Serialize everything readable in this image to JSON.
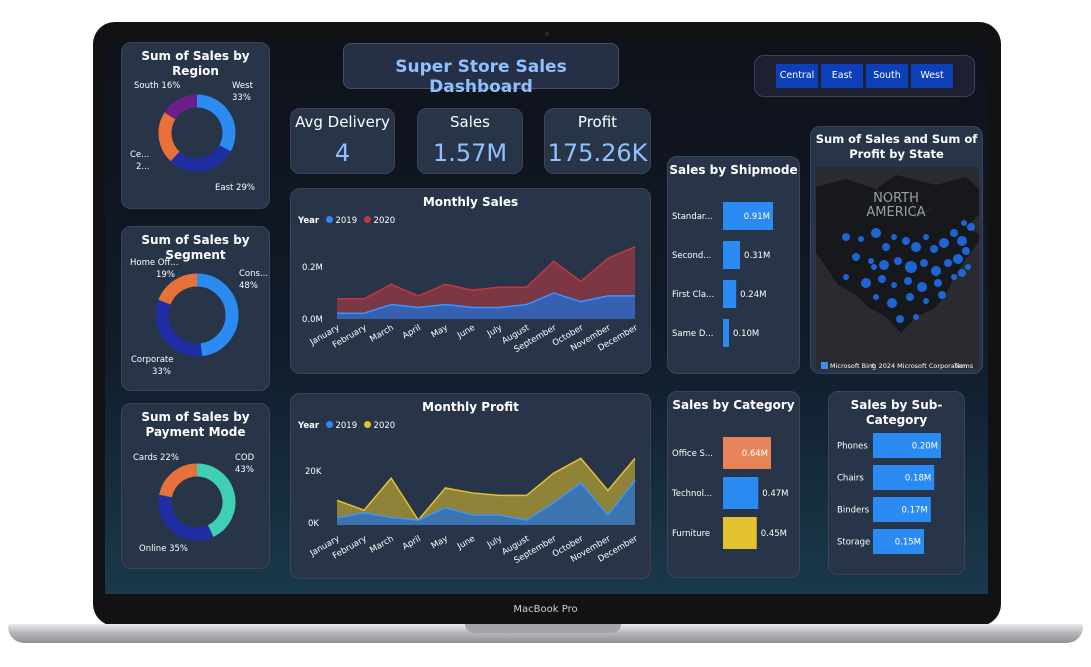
{
  "device_label": "MacBook Pro",
  "dashboard": {
    "title": "Super Store Sales Dashboard"
  },
  "colors": {
    "blue": "#2b8bf2",
    "navy": "#1f2fa3",
    "orange": "#e8703a",
    "purple": "#6a1f8a",
    "teal": "#3fd0b4",
    "red": "#c0393f",
    "yellow": "#e3c230",
    "panel": "#283548"
  },
  "slicer": {
    "options": [
      "Central",
      "East",
      "South",
      "West"
    ]
  },
  "kpis": {
    "delivery": {
      "title": "Avg Delivery",
      "value": "4"
    },
    "sales": {
      "title": "Sales",
      "value": "1.57M"
    },
    "profit": {
      "title": "Profit",
      "value": "175.26K"
    }
  },
  "region_chart": {
    "title": "Sum of Sales by Region",
    "labels": {
      "south": "South 16%",
      "west": "West",
      "west_pct": "33%",
      "central": "Ce...",
      "central_val": "2...",
      "east": "East 29%"
    }
  },
  "segment_chart": {
    "title": "Sum of Sales by Segment",
    "labels": {
      "home": "Home Off...",
      "home_pct": "19%",
      "consumer": "Cons...",
      "consumer_pct": "48%",
      "corporate": "Corporate",
      "corporate_pct": "33%"
    }
  },
  "payment_chart": {
    "title": "Sum of Sales by Payment Mode",
    "labels": {
      "cards": "Cards 22%",
      "cod": "COD",
      "cod_pct": "43%",
      "online": "Online 35%"
    }
  },
  "monthly_sales": {
    "title": "Monthly Sales",
    "legend_title": "Year",
    "series1": "2019",
    "series2": "2020",
    "ytick_high": "0.2M",
    "ytick_low": "0.0M"
  },
  "monthly_profit": {
    "title": "Monthly Profit",
    "legend_title": "Year",
    "series1": "2019",
    "series2": "2020",
    "ytick_high": "20K",
    "ytick_low": "0K"
  },
  "shipmode": {
    "title": "Sales by Shipmode"
  },
  "category": {
    "title": "Sales by Category"
  },
  "subcategory": {
    "title": "Sales by Sub-Category"
  },
  "map": {
    "title": "Sum of Sales and Sum of Profit by State",
    "region_label": "NORTH AMERICA",
    "credit_logo": "Microsoft Bing",
    "credit_text": "© 2024 Microsoft Corporation",
    "terms": "Terms"
  },
  "chart_data": [
    {
      "type": "pie",
      "title": "Sum of Sales by Region",
      "categories": [
        "West",
        "East",
        "Central",
        "South"
      ],
      "values": [
        33,
        29,
        22,
        16
      ]
    },
    {
      "type": "pie",
      "title": "Sum of Sales by Segment",
      "categories": [
        "Consumer",
        "Corporate",
        "Home Office"
      ],
      "values": [
        48,
        33,
        19
      ]
    },
    {
      "type": "pie",
      "title": "Sum of Sales by Payment Mode",
      "categories": [
        "COD",
        "Online",
        "Cards"
      ],
      "values": [
        43,
        35,
        22
      ]
    },
    {
      "type": "area",
      "title": "Monthly Sales",
      "categories": [
        "January",
        "February",
        "March",
        "April",
        "May",
        "June",
        "July",
        "August",
        "September",
        "October",
        "November",
        "December"
      ],
      "series": [
        {
          "name": "2019",
          "values": [
            0.02,
            0.02,
            0.05,
            0.04,
            0.05,
            0.04,
            0.04,
            0.05,
            0.09,
            0.06,
            0.08,
            0.08
          ]
        },
        {
          "name": "2020",
          "values": [
            0.07,
            0.07,
            0.12,
            0.08,
            0.12,
            0.1,
            0.11,
            0.11,
            0.2,
            0.13,
            0.21,
            0.25
          ]
        }
      ],
      "ylim": [
        0,
        0.27
      ],
      "ytick_labels": [
        "0.0M",
        "0.2M"
      ]
    },
    {
      "type": "area",
      "title": "Monthly Profit",
      "categories": [
        "January",
        "February",
        "March",
        "April",
        "May",
        "June",
        "July",
        "August",
        "September",
        "October",
        "November",
        "December"
      ],
      "series": [
        {
          "name": "2019",
          "values": [
            3,
            5,
            3,
            2,
            7,
            4,
            4,
            2,
            9,
            17,
            4,
            18
          ]
        },
        {
          "name": "2020",
          "values": [
            10,
            6,
            19,
            2,
            15,
            13,
            12,
            12,
            21,
            27,
            14,
            27
          ]
        }
      ],
      "ylim": [
        -2,
        32
      ],
      "ytick_labels": [
        "0K",
        "20K"
      ]
    },
    {
      "type": "bar",
      "title": "Sales by Shipmode",
      "categories": [
        "Standar...",
        "Second...",
        "First Cla...",
        "Same D..."
      ],
      "values": [
        0.91,
        0.31,
        0.24,
        0.1
      ],
      "value_labels": [
        "0.91M",
        "0.31M",
        "0.24M",
        "0.10M"
      ]
    },
    {
      "type": "bar",
      "title": "Sales by Category",
      "categories": [
        "Office S...",
        "Technol...",
        "Furniture"
      ],
      "values": [
        0.64,
        0.47,
        0.45
      ],
      "value_labels": [
        "0.64M",
        "0.47M",
        "0.45M"
      ],
      "colors": [
        "#e8845a",
        "#2b8bf2",
        "#e3c230"
      ]
    },
    {
      "type": "bar",
      "title": "Sales by Sub-Category",
      "categories": [
        "Phones",
        "Chairs",
        "Binders",
        "Storage"
      ],
      "values": [
        0.2,
        0.18,
        0.17,
        0.15
      ],
      "value_labels": [
        "0.20M",
        "0.18M",
        "0.17M",
        "0.15M"
      ]
    }
  ]
}
